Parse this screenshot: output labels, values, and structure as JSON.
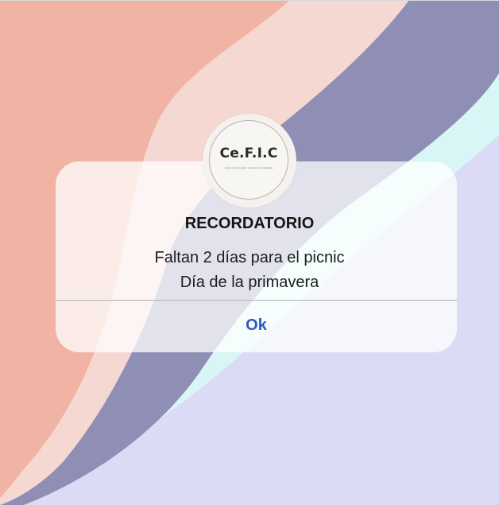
{
  "alert": {
    "logo_text": "Ce.F.I.C",
    "logo_subtext": "Centro de Formación e Inclusión Comunitaria",
    "title": "RECORDATORIO",
    "message_line1": "Faltan 2 días para el picnic",
    "message_line2": "Día de la primavera",
    "ok_label": "Ok"
  },
  "colors": {
    "salmon": "#f1b4a4",
    "pink": "#f6d8d3",
    "slate": "#8f8fb6",
    "mint": "#d9f6f6",
    "lavender": "#dcdbf6",
    "accent_blue": "#2f59c0"
  }
}
